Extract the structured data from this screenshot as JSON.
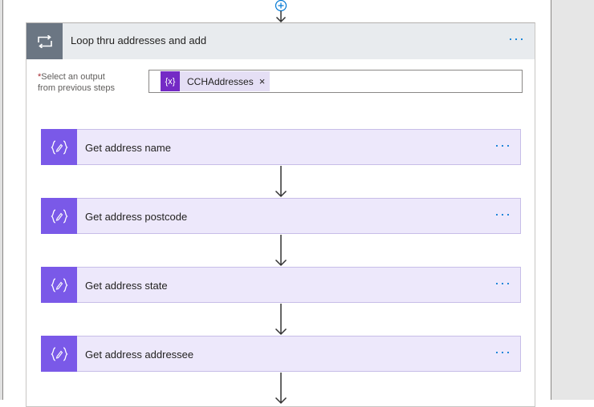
{
  "loop": {
    "title": "Loop thru addresses and add",
    "more": "···",
    "field": {
      "required_mark": "*",
      "label_line1": "Select an output",
      "label_line2": "from previous steps"
    },
    "token": {
      "icon": "{x}",
      "label": "CCHAddresses",
      "remove": "×"
    }
  },
  "steps": [
    {
      "title": "Get address name",
      "more": "···"
    },
    {
      "title": "Get address postcode",
      "more": "···"
    },
    {
      "title": "Get address state",
      "more": "···"
    },
    {
      "title": "Get address addressee",
      "more": "···"
    }
  ],
  "colors": {
    "loop_icon_bg": "#6b7683",
    "step_icon_bg": "#7a59e8",
    "step_bg": "#ede8fb",
    "token_icon_bg": "#742ac5",
    "accent": "#0078d4"
  },
  "icons": {
    "add_step": "plus-circle-icon",
    "loop": "loop-arrows-icon",
    "variable": "variable-braces-icon",
    "arrow": "down-arrow-icon"
  }
}
